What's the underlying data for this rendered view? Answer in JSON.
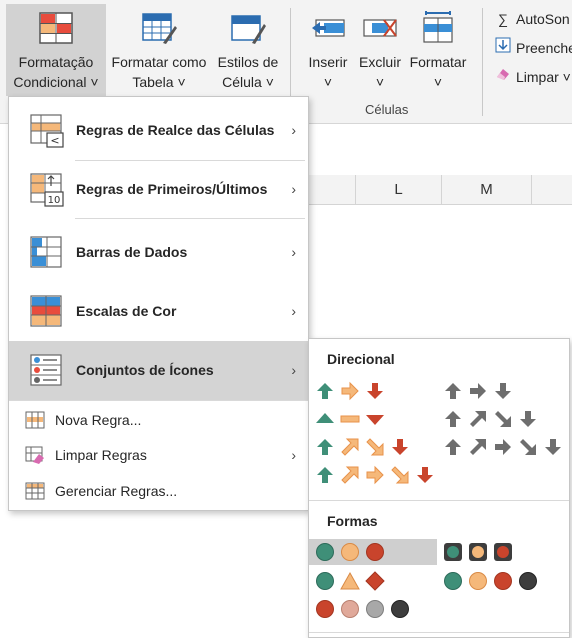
{
  "ribbon": {
    "buttons": [
      {
        "line1": "Formatação",
        "line2": "Condicional ˅"
      },
      {
        "line1": "Formatar como",
        "line2": "Tabela ˅"
      },
      {
        "line1": "Estilos de",
        "line2": "Célula ˅"
      },
      {
        "line1": "Inserir",
        "line2": "˅"
      },
      {
        "line1": "Excluir",
        "line2": "˅"
      },
      {
        "line1": "Formatar",
        "line2": "˅"
      }
    ],
    "group_label": "Células",
    "autosum": "AutoSon",
    "fill": "Preenche",
    "clear": "Limpar ˅"
  },
  "sheet": {
    "columns": [
      "L",
      "M"
    ]
  },
  "menu": {
    "items": [
      {
        "label": "Regras de Realce das Células",
        "icon": "highlight-rules-icon"
      },
      {
        "label": "Regras de Primeiros/Últimos",
        "icon": "top-bottom-rules-icon"
      },
      {
        "label": "Barras de Dados",
        "icon": "data-bars-icon"
      },
      {
        "label": "Escalas de Cor",
        "icon": "color-scales-icon"
      },
      {
        "label": "Conjuntos de Ícones",
        "icon": "icon-sets-icon"
      }
    ],
    "small_items": [
      {
        "label": "Nova Regra...",
        "icon": "new-rule-icon"
      },
      {
        "label": "Limpar Regras",
        "icon": "clear-rules-icon"
      },
      {
        "label": "Gerenciar Regras...",
        "icon": "manage-rules-icon"
      }
    ],
    "arrow": "›"
  },
  "submenu": {
    "directional_title": "Direcional",
    "shapes_title": "Formas",
    "colors": {
      "green": "#3f8f78",
      "orange": "#e8924a",
      "red": "#c9442c",
      "yellow_light": "#f5b87a",
      "gray": "#6e6e6e",
      "dark": "#3d3d3d",
      "pink": "#e0a99a",
      "light_gray": "#a8a8a8"
    }
  }
}
